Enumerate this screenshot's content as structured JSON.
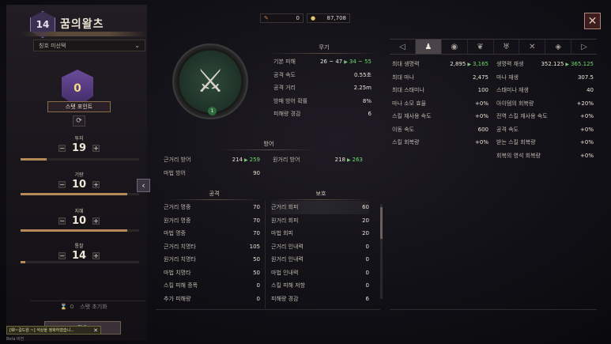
{
  "header": {
    "level": "14",
    "title": "꿈의왈츠"
  },
  "left": {
    "title_select": "칭호 미선택",
    "points": "0",
    "stat_point_btn": "스탯 포인트",
    "stats": [
      {
        "label": "투지",
        "value": "19",
        "fill": 0.22
      },
      {
        "label": "기량",
        "value": "10",
        "fill": 0.9
      },
      {
        "label": "지혜",
        "value": "10",
        "fill": 0.9
      },
      {
        "label": "통찰",
        "value": "14",
        "fill": 0.04
      }
    ],
    "reset_count": "0",
    "reset_label": "스탯 초기화",
    "apply": "적용",
    "toast": "[Ŵ~길드원 ~] 석상을 정화하였습니...",
    "beta": "Beta 버전"
  },
  "currency": {
    "a": "0",
    "b": "87,708"
  },
  "weapon": {
    "head": "무기",
    "level": "1",
    "rows": [
      {
        "label": "기본 피해",
        "base": "26 ~ 47",
        "new": "34 ~ 55"
      },
      {
        "label": "공격 속도",
        "value": "0.55초"
      },
      {
        "label": "공격 거리",
        "value": "2.25m"
      },
      {
        "label": "방패 방어 확률",
        "value": "8%"
      },
      {
        "label": "피해량 경감",
        "value": "6"
      }
    ]
  },
  "defense": {
    "head": "방어",
    "melee": {
      "label": "근거리 방어",
      "base": "214",
      "new": "259"
    },
    "ranged": {
      "label": "원거리 방어",
      "base": "218",
      "new": "263"
    },
    "magic": {
      "label": "마법 방어",
      "value": "90"
    }
  },
  "attack": {
    "head": "공격",
    "rows": [
      {
        "label": "근거리 명중",
        "value": "70"
      },
      {
        "label": "원거리 명중",
        "value": "70"
      },
      {
        "label": "마법 명중",
        "value": "70"
      },
      {
        "label": "근거리 치명타",
        "value": "105"
      },
      {
        "label": "원거리 치명타",
        "value": "50"
      },
      {
        "label": "마법 치명타",
        "value": "50"
      },
      {
        "label": "스킬 피해 증폭",
        "value": "0"
      },
      {
        "label": "추가 피해량",
        "value": "0"
      }
    ]
  },
  "protect": {
    "head": "보호",
    "rows": [
      {
        "label": "근거리 회피",
        "value": "60"
      },
      {
        "label": "원거리 회피",
        "value": "20"
      },
      {
        "label": "마법 회피",
        "value": "20"
      },
      {
        "label": "근거리 인내력",
        "value": "0"
      },
      {
        "label": "원거리 인내력",
        "value": "0"
      },
      {
        "label": "마법 인내력",
        "value": "0"
      },
      {
        "label": "스킬 피해 저항",
        "value": "0"
      },
      {
        "label": "피해량 경감",
        "value": "6"
      }
    ]
  },
  "right": {
    "col1": [
      {
        "label": "최대 생명력",
        "base": "2,895",
        "new": "3,165"
      },
      {
        "label": "최대 마나",
        "value": "2,475"
      },
      {
        "label": "최대 스태미나",
        "value": "100"
      },
      {
        "label": "마나 소모 효율",
        "value": "+0%"
      },
      {
        "label": "스킬 재사용 속도",
        "value": "+0%"
      },
      {
        "label": "이동 속도",
        "value": "600"
      },
      {
        "label": "스킬 회복량",
        "value": "+0%"
      }
    ],
    "col2": [
      {
        "label": "생명력 재생",
        "base": "352.125",
        "new": "365.125"
      },
      {
        "label": "마나 재생",
        "value": "307.5"
      },
      {
        "label": "스태미나 재생",
        "value": "40"
      },
      {
        "label": "아이템의 회복량",
        "value": "+20%"
      },
      {
        "label": "전역 스킬 재사용 속도",
        "value": "+0%"
      },
      {
        "label": "공격 속도",
        "value": "+0%"
      },
      {
        "label": "받는 스킬 회복량",
        "value": "+0%"
      },
      {
        "label": "회복의 영석 회복량",
        "value": "+0%"
      }
    ]
  }
}
